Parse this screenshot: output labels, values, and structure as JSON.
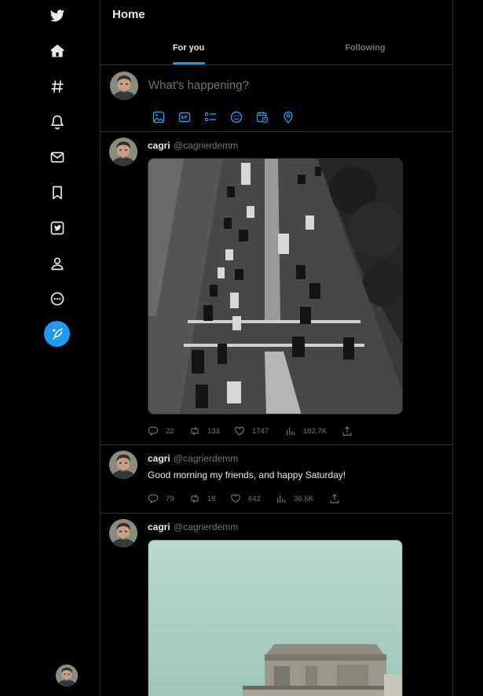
{
  "header": {
    "title": "Home"
  },
  "tabs": [
    {
      "label": "For you"
    },
    {
      "label": "Following"
    }
  ],
  "composer": {
    "placeholder": "What's happening?"
  },
  "sidebar": {
    "items": [
      "twitter-logo",
      "home",
      "explore-hashtag",
      "notifications",
      "messages",
      "bookmarks",
      "twitter-blue",
      "profile",
      "more"
    ],
    "compose_color": "#1d9bf0"
  },
  "tweets": [
    {
      "name": "cagri",
      "handle": "@cagrierdemm",
      "text": "",
      "media": "traffic-photo",
      "replies": "22",
      "retweets": "133",
      "likes": "1747",
      "views": "182.7K"
    },
    {
      "name": "cagri",
      "handle": "@cagrierdemm",
      "text": "Good morning my friends, and happy Saturday!",
      "replies": "79",
      "retweets": "18",
      "likes": "642",
      "views": "36.5K"
    },
    {
      "name": "cagri",
      "handle": "@cagrierdemm",
      "text": "",
      "media": "building-photo"
    }
  ],
  "colors": {
    "accent": "#1d9bf0",
    "background": "#000000",
    "muted": "#71767b",
    "border": "#2f3336"
  }
}
